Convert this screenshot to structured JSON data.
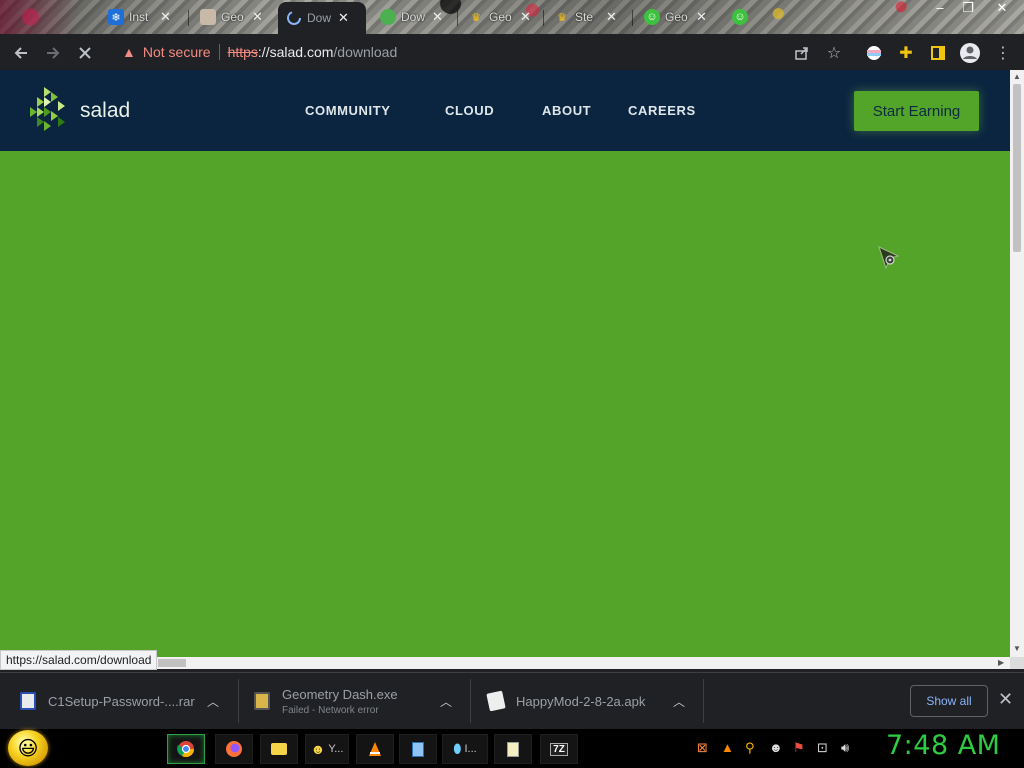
{
  "tabs": [
    {
      "title": "Inst",
      "favicon": "snowflake-icon"
    },
    {
      "title": "Geo",
      "favicon": "avatar-icon"
    },
    {
      "title": "Dow",
      "favicon": "loading-spinner-icon",
      "active": true
    },
    {
      "title": "Dow",
      "favicon": "globe-icon"
    },
    {
      "title": "Geo",
      "favicon": "crown-icon"
    },
    {
      "title": "Ste",
      "favicon": "crown-icon"
    },
    {
      "title": "Geo",
      "favicon": "smiley-icon"
    }
  ],
  "address_bar": {
    "security_label": "Not secure",
    "url_protocol": "https",
    "url_host": "://salad.com",
    "url_path": "/download"
  },
  "site": {
    "logo_text": "salad",
    "nav": [
      "COMMUNITY",
      "CLOUD",
      "ABOUT",
      "CAREERS"
    ],
    "cta_label": "Start Earning",
    "background_color": "#55a42a",
    "header_color": "#0b2540"
  },
  "status_url": "https://salad.com/download",
  "downloads": [
    {
      "name": "C1Setup-Password-....rar",
      "status": ""
    },
    {
      "name": "Geometry Dash.exe",
      "status": "Failed - Network error"
    },
    {
      "name": "HappyMod-2-8-2a.apk",
      "status": ""
    }
  ],
  "shelf": {
    "show_all_label": "Show all"
  },
  "taskbar": {
    "apps": [
      {
        "icon": "chrome-icon",
        "label": ""
      },
      {
        "icon": "firefox-icon",
        "label": ""
      },
      {
        "icon": "folder-icon",
        "label": ""
      },
      {
        "icon": "smiley-icon",
        "label": "Y..."
      },
      {
        "icon": "vlc-icon",
        "label": ""
      },
      {
        "icon": "notepad-icon",
        "label": ""
      },
      {
        "icon": "app-icon",
        "label": "I..."
      },
      {
        "icon": "document-icon",
        "label": ""
      },
      {
        "icon": "7zip-icon",
        "label": "7Z"
      }
    ],
    "clock": "7:48 AM"
  }
}
